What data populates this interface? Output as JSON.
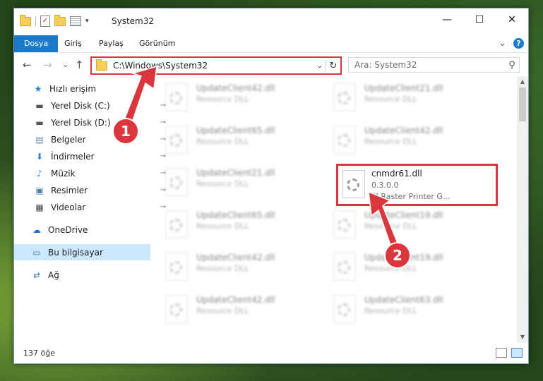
{
  "titlebar": {
    "title": "System32",
    "minimize": "—",
    "maximize": "☐",
    "close": "✕"
  },
  "ribbon": {
    "tabs": [
      "Dosya",
      "Giriş",
      "Paylaş",
      "Görünüm"
    ],
    "active_tab": "Dosya",
    "help": "?",
    "expand": "⌄"
  },
  "navbar": {
    "back": "←",
    "forward": "→",
    "recent": "⌄",
    "up": "↑",
    "address": "C:\\Windows\\System32",
    "address_dropdown": "⌄",
    "refresh": "↻",
    "search_placeholder": "Ara: System32",
    "search_icon": "⚲"
  },
  "sidebar": {
    "items": [
      {
        "label": "Hızlı erişim",
        "icon": "star-icon",
        "glyph": "★"
      },
      {
        "label": "Yerel Disk (C:)",
        "icon": "drive-icon",
        "glyph": "▬",
        "pinned": true
      },
      {
        "label": "Yerel Disk (D:)",
        "icon": "drive-icon",
        "glyph": "▬",
        "pinned": true
      },
      {
        "label": "Belgeler",
        "icon": "documents-icon",
        "glyph": "▤",
        "pinned": true
      },
      {
        "label": "İndirmeler",
        "icon": "download-icon",
        "glyph": "⬇",
        "pinned": true
      },
      {
        "label": "Müzik",
        "icon": "music-icon",
        "glyph": "♪",
        "pinned": true
      },
      {
        "label": "Resimler",
        "icon": "pictures-icon",
        "glyph": "▣",
        "pinned": true
      },
      {
        "label": "Videolar",
        "icon": "video-icon",
        "glyph": "▦",
        "pinned": true
      },
      {
        "label": "OneDrive",
        "icon": "cloud-icon",
        "glyph": "☁"
      },
      {
        "label": "Bu bilgisayar",
        "icon": "computer-icon",
        "glyph": "▭",
        "selected": true
      },
      {
        "label": "Ağ",
        "icon": "network-icon",
        "glyph": "⇄"
      }
    ],
    "pin_glyph": "📌"
  },
  "files": {
    "left": [
      {
        "name": "UpdateClient42.dll",
        "type": "Resource DLL"
      },
      {
        "name": "UpdateClient65.dll",
        "type": "Resource DLL"
      },
      {
        "name": "UpdateClient21.dll",
        "type": "Resource DLL"
      },
      {
        "name": "UpdateClient65.dll",
        "type": "Resource DLL"
      },
      {
        "name": "UpdateClient42.dll",
        "type": "Resource DLL"
      },
      {
        "name": "UpdateClient42.dll",
        "type": "Resource DLL"
      }
    ],
    "right": [
      {
        "name": "UpdateClient21.dll",
        "type": "Resource DLL"
      },
      {
        "name": "UpdateClient42.dll",
        "type": "Resource DLL"
      },
      {
        "name": "cnmdr61.dll",
        "version": "0.3.0.0",
        "type": "PJ Raster Printer G...",
        "highlighted": true
      },
      {
        "name": "UpdateClient19.dll",
        "type": "Resource DLL"
      },
      {
        "name": "UpdateClient19.dll",
        "type": "Resource DLL"
      },
      {
        "name": "UpdateClient63.dll",
        "type": "Resource DLL"
      }
    ]
  },
  "status": {
    "count": "137 öğe"
  },
  "annotations": [
    {
      "number": "1",
      "color": "#d9363e"
    },
    {
      "number": "2",
      "color": "#d9363e"
    }
  ]
}
